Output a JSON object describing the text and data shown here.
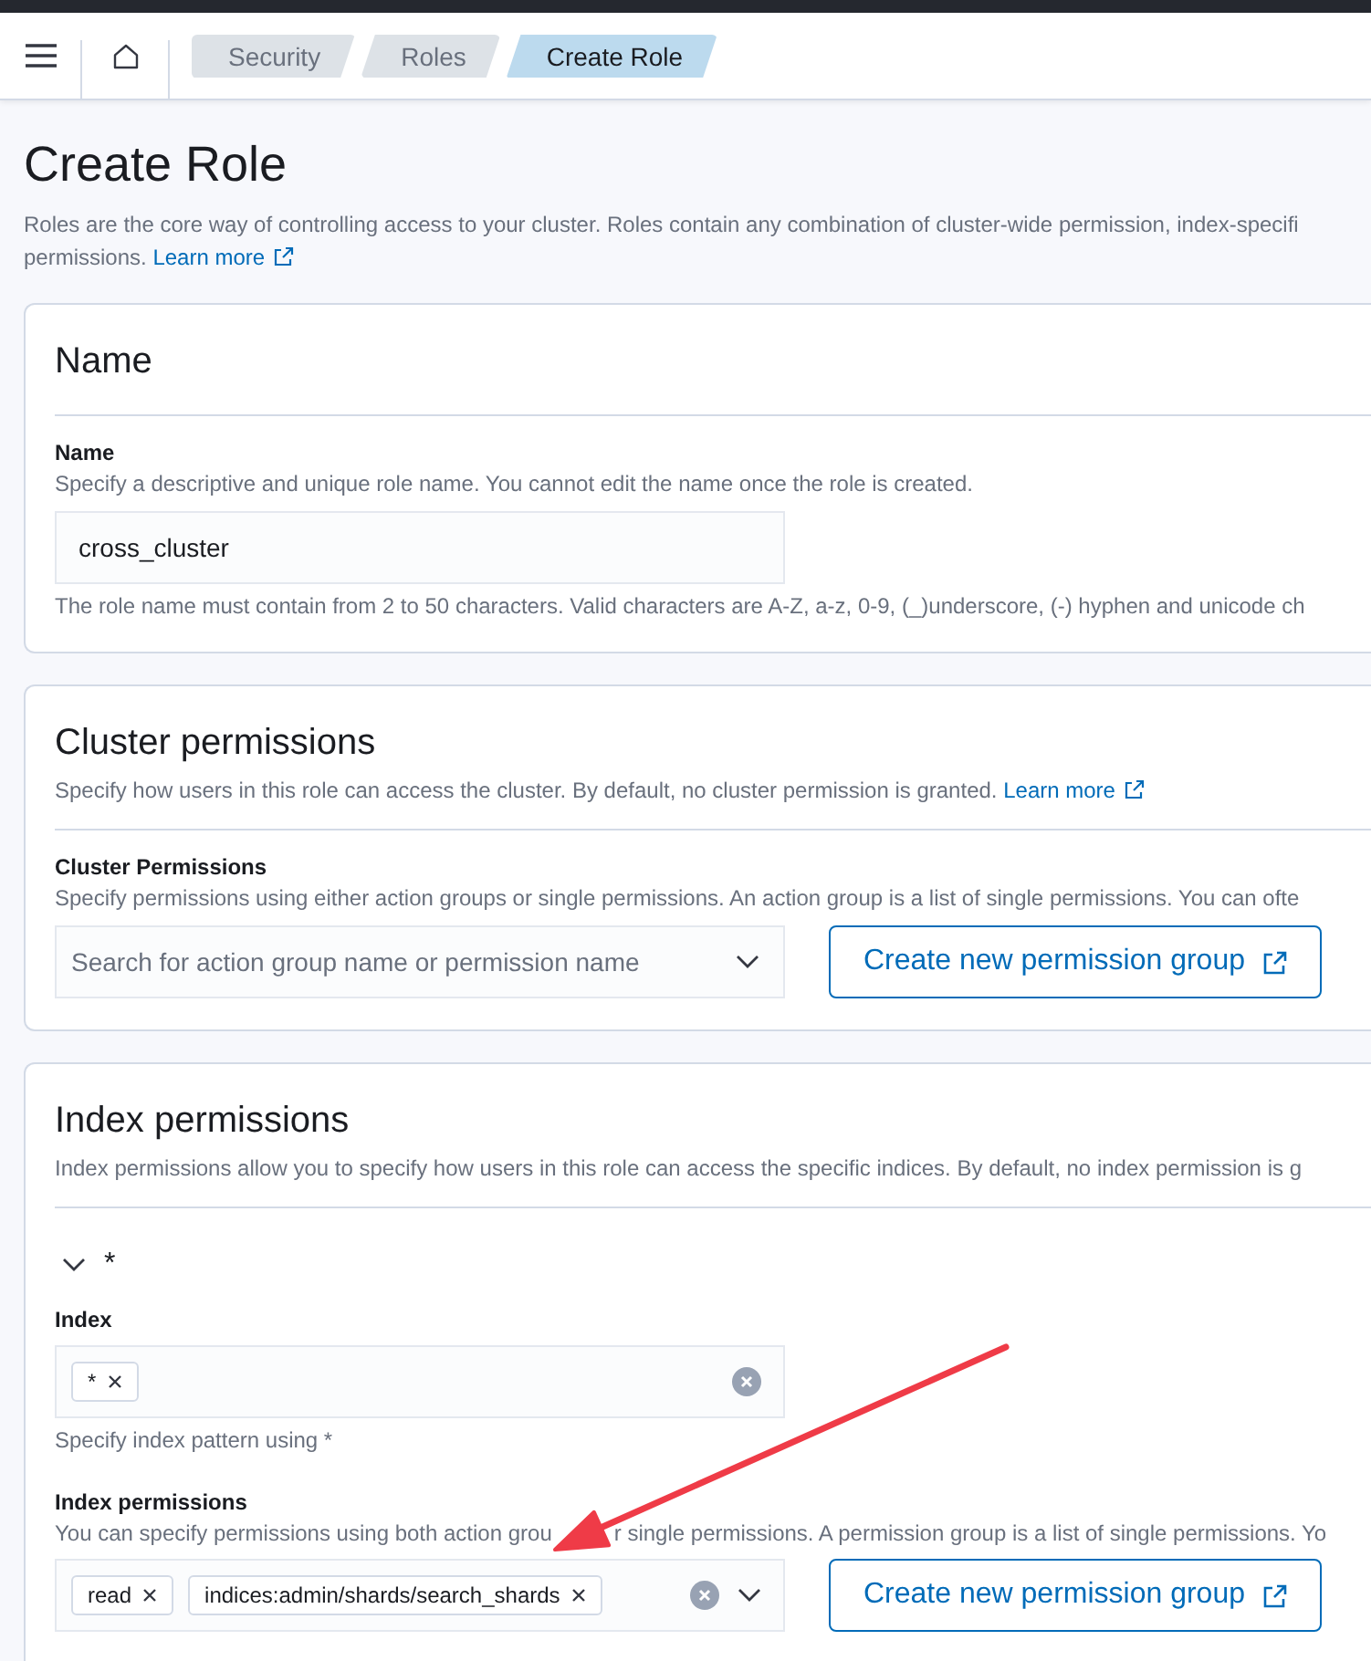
{
  "header": {
    "breadcrumbs": [
      {
        "label": "Security",
        "selected": false
      },
      {
        "label": "Roles",
        "selected": false
      },
      {
        "label": "Create Role",
        "selected": true
      }
    ]
  },
  "page": {
    "title": "Create Role",
    "description_lines": [
      "Roles are the core way of controlling access to your cluster. Roles contain any combination of cluster-wide permission, index-specifi",
      "permissions."
    ],
    "learn_more": "Learn more"
  },
  "name_section": {
    "title": "Name",
    "field": {
      "label": "Name",
      "help": "Specify a descriptive and unique role name. You cannot edit the name once the role is created.",
      "value": "cross_cluster",
      "note": "The role name must contain from 2 to 50 characters. Valid characters are A-Z, a-z, 0-9, (_)underscore, (-) hyphen and unicode ch"
    }
  },
  "cluster_section": {
    "title": "Cluster permissions",
    "description": "Specify how users in this role can access the cluster. By default, no cluster permission is granted.",
    "learn_more": "Learn more",
    "field": {
      "label": "Cluster Permissions",
      "help": "Specify permissions using either action groups or single permissions. An action group is a list of single permissions. You can ofte",
      "placeholder": "Search for action group name or permission name",
      "button": "Create new permission group"
    }
  },
  "index_section": {
    "title": "Index permissions",
    "description": "Index permissions allow you to specify how users in this role can access the specific indices. By default, no index permission is g",
    "entries": [
      {
        "title": "*",
        "expanded": true,
        "index_field": {
          "label": "Index",
          "tags": [
            "*"
          ],
          "note": "Specify index pattern using *"
        },
        "permissions_field": {
          "label": "Index permissions",
          "help_parts": [
            "You can specify permissions using both action grou",
            "r single permissions. A permission group is a list of single permissions. Yo"
          ],
          "tags": [
            "read",
            "indices:admin/shards/search_shards"
          ],
          "button": "Create new permission group"
        }
      }
    ]
  }
}
